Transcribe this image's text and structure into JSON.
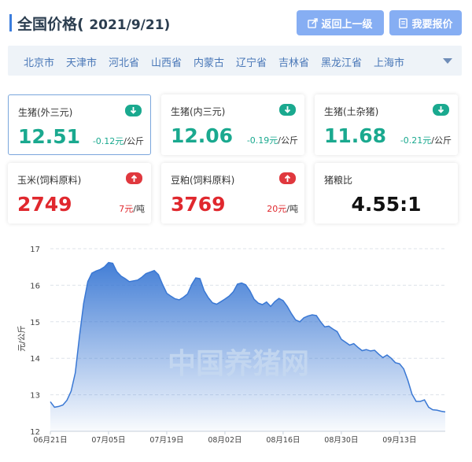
{
  "header": {
    "title": "全国价格(",
    "date": "2021/9/21)",
    "back_label": "返回上一级",
    "report_label": "我要报价"
  },
  "colors": {
    "accent": "#3b7ddd",
    "down": "#1aa98f",
    "up": "#e0383e",
    "button": "#86aef3",
    "watermark": "#c6d8f0"
  },
  "cities": [
    "北京市",
    "天津市",
    "河北省",
    "山西省",
    "内蒙古",
    "辽宁省",
    "吉林省",
    "黑龙江省",
    "上海市"
  ],
  "cards": [
    {
      "label": "生猪(外三元)",
      "value": "12.51",
      "change": "-0.12元",
      "unit": "/公斤",
      "direction": "down",
      "icon": "arrow-down-icon"
    },
    {
      "label": "生猪(内三元)",
      "value": "12.06",
      "change": "-0.19元",
      "unit": "/公斤",
      "direction": "down",
      "icon": "arrow-down-icon"
    },
    {
      "label": "生猪(土杂猪)",
      "value": "11.68",
      "change": "-0.21元",
      "unit": "/公斤",
      "direction": "down",
      "icon": "arrow-down-icon"
    },
    {
      "label": "玉米(饲料原料)",
      "value": "2749",
      "change": "7元",
      "unit": "/吨",
      "direction": "up",
      "icon": "arrow-up-icon"
    },
    {
      "label": "豆粕(饲料原料)",
      "value": "3769",
      "change": "20元",
      "unit": "/吨",
      "direction": "up",
      "icon": "arrow-up-icon"
    },
    {
      "label": "猪粮比",
      "value": "4.55:1"
    }
  ],
  "chart_data": {
    "type": "area",
    "ylabel": "元/公斤",
    "ylim": [
      12,
      17
    ],
    "yticks": [
      12,
      13,
      14,
      15,
      16,
      17
    ],
    "xticks": [
      "06月21日",
      "07月05日",
      "07月19日",
      "08月02日",
      "08月16日",
      "08月30日",
      "09月13日"
    ],
    "watermark": "中国养猪网",
    "grid": true,
    "series": [
      {
        "values": [
          12.81,
          12.66,
          12.68,
          12.72,
          12.85,
          13.1,
          13.6,
          14.6,
          15.5,
          16.1,
          16.33,
          16.39,
          16.43,
          16.5,
          16.62,
          16.6,
          16.37,
          16.25,
          16.18,
          16.1,
          16.12,
          16.14,
          16.22,
          16.32,
          16.36,
          16.4,
          16.29,
          16.02,
          15.78,
          15.7,
          15.63,
          15.6,
          15.67,
          15.76,
          16.02,
          16.2,
          16.18,
          15.85,
          15.66,
          15.52,
          15.48,
          15.55,
          15.62,
          15.7,
          15.82,
          16.03,
          16.06,
          16.01,
          15.85,
          15.62,
          15.51,
          15.47,
          15.54,
          15.42,
          15.55,
          15.64,
          15.58,
          15.42,
          15.22,
          15.05,
          15.0,
          15.11,
          15.16,
          15.19,
          15.17,
          15.0,
          14.86,
          14.88,
          14.8,
          14.73,
          14.52,
          14.44,
          14.36,
          14.4,
          14.3,
          14.21,
          14.24,
          14.2,
          14.22,
          14.11,
          14.02,
          14.09,
          14.0,
          13.88,
          13.85,
          13.71,
          13.4,
          13.02,
          12.82,
          12.82,
          12.86,
          12.66,
          12.59,
          12.58,
          12.55,
          12.53
        ]
      }
    ]
  }
}
